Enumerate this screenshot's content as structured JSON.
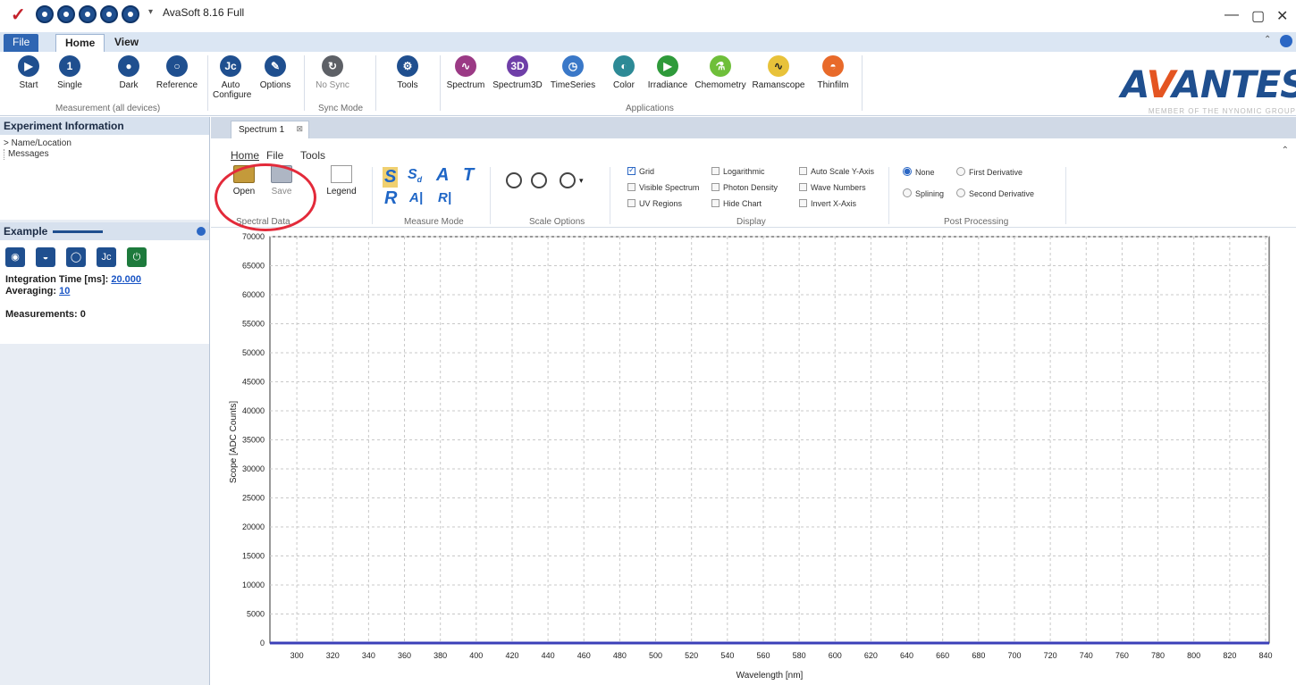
{
  "window": {
    "title": "AvaSoft 8.16 Full",
    "controls": {
      "minimize": "—",
      "restore": "▢",
      "close": "✕"
    }
  },
  "menu": {
    "file": "File",
    "home": "Home",
    "view": "View"
  },
  "ribbon": {
    "measurement": {
      "start": "Start",
      "single": "Single",
      "dark": "Dark",
      "reference": "Reference",
      "group": "Measurement (all devices)"
    },
    "auto_configure": "Auto\nConfigure",
    "options": "Options",
    "sync": {
      "no_sync": "No Sync",
      "group": "Sync Mode"
    },
    "tools": "Tools",
    "applications": {
      "items": [
        "Spectrum",
        "Spectrum3D",
        "TimeSeries",
        "Color",
        "Irradiance",
        "Chemometry",
        "Ramanscope",
        "Thinfilm"
      ],
      "group": "Applications"
    }
  },
  "logo": {
    "brand_a": "A",
    "brand_v": "V",
    "brand_rest": "ANTES",
    "tagline": "MEMBER OF THE NYNOMIC GROUP"
  },
  "experiment": {
    "title": "Experiment Information",
    "tree": [
      "> Name/Location",
      "Messages"
    ]
  },
  "example": {
    "title": "Example",
    "integration_label": "Integration Time [ms]: ",
    "integration_value": "20.000",
    "averaging_label": "Averaging: ",
    "averaging_value": "10",
    "measurements": "Measurements: 0"
  },
  "document": {
    "tab": "Spectrum 1",
    "subtabs": {
      "home": "Home",
      "file": "File",
      "tools": "Tools"
    },
    "spectral": {
      "open": "Open",
      "save": "Save",
      "legend": "Legend",
      "group": "Spectral Data"
    },
    "measure_mode": {
      "group": "Measure Mode"
    },
    "scale": {
      "group": "Scale Options"
    },
    "display": {
      "grid": "Grid",
      "visible_spectrum": "Visible Spectrum",
      "uv_regions": "UV Regions",
      "logarithmic": "Logarithmic",
      "photon_density": "Photon Density",
      "hide_chart": "Hide Chart",
      "auto_scale": "Auto Scale Y-Axis",
      "wave_numbers": "Wave Numbers",
      "invert_x": "Invert X-Axis",
      "group": "Display"
    },
    "post": {
      "none": "None",
      "first_derivative": "First Derivative",
      "splining": "Splining",
      "second_derivative": "Second Derivative",
      "group": "Post Processing"
    }
  },
  "chart_data": {
    "type": "line",
    "xlabel": "Wavelength [nm]",
    "ylabel": "Scope [ADC Counts]",
    "xlim": [
      285,
      842
    ],
    "ylim": [
      0,
      70000
    ],
    "xticks": [
      300,
      320,
      340,
      360,
      380,
      400,
      420,
      440,
      460,
      480,
      500,
      520,
      540,
      560,
      580,
      600,
      620,
      640,
      660,
      680,
      700,
      720,
      740,
      760,
      780,
      800,
      820,
      840
    ],
    "yticks": [
      0,
      5000,
      10000,
      15000,
      20000,
      25000,
      30000,
      35000,
      40000,
      45000,
      50000,
      55000,
      60000,
      65000,
      70000
    ],
    "grid": true,
    "series": [
      {
        "color": "#3b3fb8",
        "x": [
          285,
          842
        ],
        "y": [
          0,
          0
        ]
      }
    ]
  }
}
